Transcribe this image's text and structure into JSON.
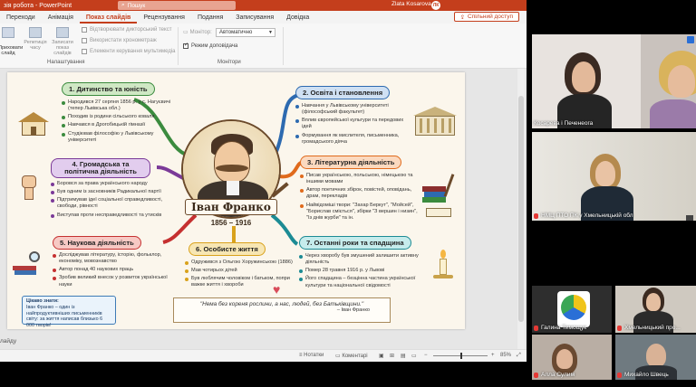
{
  "titlebar": {
    "title": "зія робота  -  PowerPoint",
    "search_placeholder": "Пошук",
    "user_name": "Zlata Kosarova",
    "user_initials": "ЛК",
    "bg_color": "#c43e1c"
  },
  "tabs": [
    {
      "label": "Переходи",
      "active": false
    },
    {
      "label": "Анімація",
      "active": false
    },
    {
      "label": "Показ слайдів",
      "active": true
    },
    {
      "label": "Рецензування",
      "active": false
    },
    {
      "label": "Подання",
      "active": false
    },
    {
      "label": "Записування",
      "active": false
    },
    {
      "label": "Довідка",
      "active": false
    }
  ],
  "share_button": "Спільний доступ",
  "ribbon": {
    "btn_hide": "Приховати слайд",
    "btn_rehearse": "Репетиція часу",
    "btn_record": "Записати показ слайдів",
    "chk_narrations": "Відтворювати дикторський текст",
    "chk_timings": "Використати хронометраж",
    "chk_media": "Елементи керування мультимедіа",
    "group_setup": "Налаштування",
    "monitor_label": "Монітор:",
    "monitor_value": "Автоматично",
    "chk_presenter": "Режим доповідача",
    "group_monitors": "Монітори",
    "left_cut": "оказу ів"
  },
  "slide": {
    "title_name": "Іван Франко",
    "years": "1856 – 1916",
    "sections": {
      "s1": {
        "title": "1. Дитинство та юність",
        "items": [
          "Народився 27 серпня 1856 р. у с. Нагуєвичі (тепер Львівська обл.)",
          "Походив із родини сільського коваля",
          "Навчався в Дрогобицькій гімназії",
          "Студіював філософію у Львівському університеті"
        ]
      },
      "s2": {
        "title": "2. Освіта і становлення",
        "items": [
          "Навчання у Львівському університеті (філософський факультет)",
          "Вплив європейської культури та передових ідей",
          "Формування як мислителя, письменника, громадського діяча"
        ]
      },
      "s3": {
        "title": "3. Літературна діяльність",
        "items": [
          "Писав українською, польською, німецькою та іншими мовами",
          "Автор поетичних збірок, повістей, оповідань, драм, перекладів",
          "Найвідоміші твори: \"Захар Беркут\", \"Мойсей\", \"Борислав сміється\", збірки \"З вершин і низин\", \"Із днів журби\" та ін."
        ]
      },
      "s4": {
        "title": "4. Громадська та політична діяльність",
        "items": [
          "Боровся за права українського народу",
          "Був одним із засновників Радикальної партії",
          "Підтримував ідеї соціальної справедливості, свободи, рівності",
          "Виступав проти несправедливості та утисків"
        ]
      },
      "s5": {
        "title": "5. Наукова діяльність",
        "items": [
          "Досліджував літературу, історію, фольклор, економіку, мовознавство",
          "Автор понад 40 наукових праць",
          "Зробив великий внесок у розвиток української науки"
        ]
      },
      "s6": {
        "title": "6. Особисте життя",
        "items": [
          "Одружився з Ольгою Хоружинською (1886)",
          "Мав чотирьох дітей",
          "Був люблячим чоловіком і батьком, попри важке життя і хвороби"
        ]
      },
      "s7": {
        "title": "7. Останні роки та спадщина",
        "items": [
          "Через хворобу був змушений залишити активну діяльність",
          "Помер 28 травня 1916 р. у Львові",
          "Його спадщина – безцінна частина української культури та національної свідомості"
        ]
      }
    },
    "fact": {
      "title": "Цікаво знати:",
      "text": "Іван Франко – один із найпродуктивніших письменників світу: за життя написав близько 6 000 творів!"
    },
    "quote": {
      "text": "\"Нема без кореня рослини, а нас, людей, без Батьківщини.\"",
      "author": "– Іван Франко"
    }
  },
  "notes_hint": "лайду",
  "statusbar": {
    "notes": "Нотатки",
    "comments": "Коментарі",
    "zoom": "85%"
  },
  "video": {
    "tiles": [
      {
        "name": "Косарева і Печенеога",
        "muted": false
      },
      {
        "name": "НМЦ ПТО ПК у Хмельницькій обл",
        "muted": true
      },
      {
        "name": "Галина Тимощук",
        "muted": true
      },
      {
        "name": "Хмельницький про...",
        "muted": true
      },
      {
        "name": "Алла Сулим",
        "muted": true
      },
      {
        "name": "Михайло Швець",
        "muted": true
      }
    ]
  }
}
